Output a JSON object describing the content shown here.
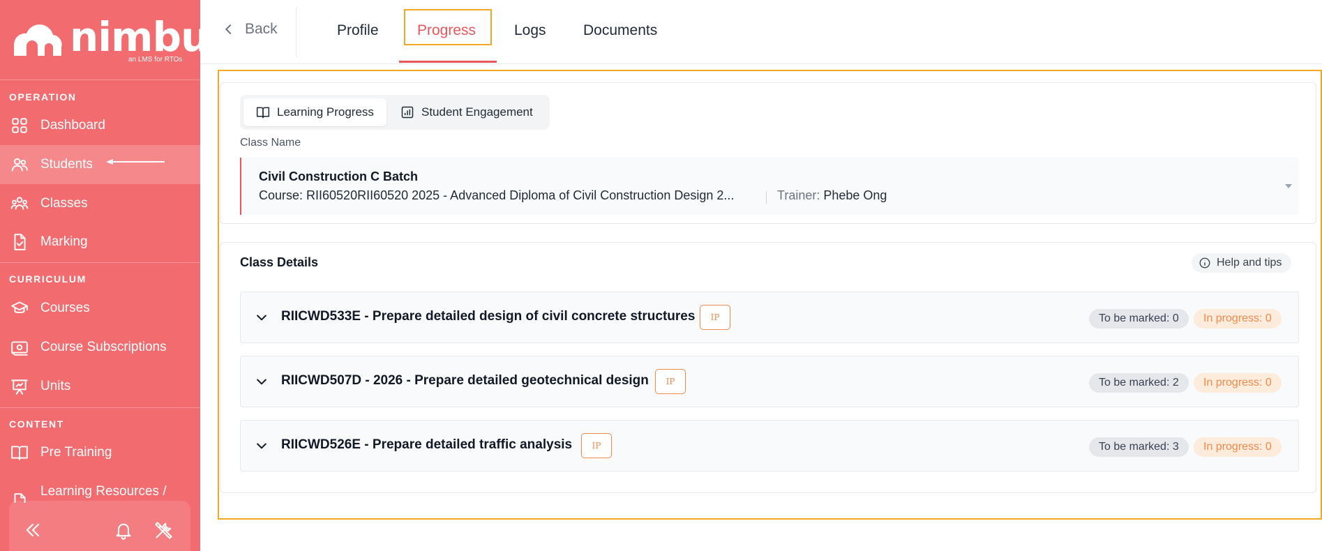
{
  "app": {
    "brand": "nimbu",
    "tagline": "an LMS for RTOs"
  },
  "colors": {
    "sidebar": "#f26b6f",
    "accent": "#e8565c",
    "highlight": "#f5a623",
    "ip_badge": "#f08a4b"
  },
  "sidebar": {
    "sections": [
      {
        "title": "OPERATION"
      },
      {
        "title": "CURRICULUM"
      },
      {
        "title": "CONTENT"
      }
    ],
    "items": [
      {
        "label": "Dashboard",
        "icon": "dashboard-icon"
      },
      {
        "label": "Students",
        "icon": "users-icon",
        "active": true
      },
      {
        "label": "Classes",
        "icon": "classes-icon"
      },
      {
        "label": "Marking",
        "icon": "marking-icon"
      },
      {
        "label": "Courses",
        "icon": "graduation-cap-icon"
      },
      {
        "label": "Course Subscriptions",
        "icon": "subscription-icon"
      },
      {
        "label": "Units",
        "icon": "presentation-icon"
      },
      {
        "label": "Pre Training",
        "icon": "book-icon"
      },
      {
        "label": "Learning Resources /",
        "icon": "document-icon"
      }
    ]
  },
  "topbar": {
    "back": "Back",
    "tabs": [
      {
        "label": "Profile"
      },
      {
        "label": "Progress",
        "active": true
      },
      {
        "label": "Logs"
      },
      {
        "label": "Documents"
      }
    ]
  },
  "progress": {
    "segments": [
      {
        "label": "Learning Progress",
        "icon": "book-icon",
        "active": true
      },
      {
        "label": "Student Engagement",
        "icon": "bar-chart-icon"
      }
    ],
    "class_name_label": "Class Name",
    "class": {
      "title": "Civil Construction C Batch",
      "course": "Course: RII60520RII60520 2025 - Advanced Diploma of Civil Construction Design 2...",
      "trainer_label": "Trainer:",
      "trainer": "Phebe Ong"
    }
  },
  "class_details": {
    "title": "Class Details",
    "help": "Help and tips",
    "units": [
      {
        "name": "RIICWD533E - Prepare detailed design of civil concrete structures",
        "badge": "IP",
        "to_be_marked": "To be marked: 0",
        "in_progress": "In progress: 0"
      },
      {
        "name": "RIICWD507D - 2026 - Prepare detailed geotechnical design",
        "badge": "IP",
        "to_be_marked": "To be marked: 2",
        "in_progress": "In progress: 0"
      },
      {
        "name": "RIICWD526E - Prepare detailed traffic analysis",
        "badge": "IP",
        "to_be_marked": "To be marked: 3",
        "in_progress": "In progress: 0"
      }
    ]
  }
}
